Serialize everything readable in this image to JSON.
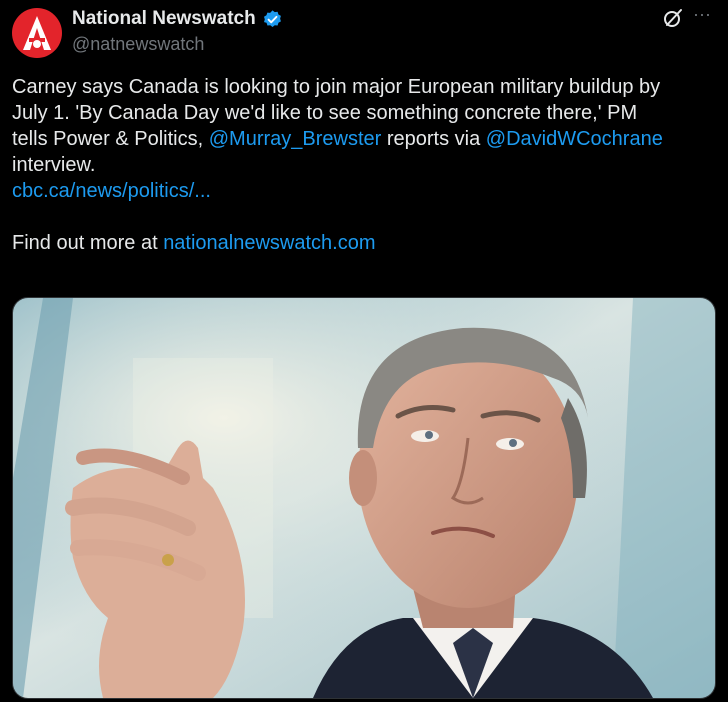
{
  "author": {
    "display_name": "National Newswatch",
    "handle": "@natnewswatch",
    "verified": true,
    "avatar_color": "#e3242b"
  },
  "tweet": {
    "line1": "Carney says Canada is looking to join major European military buildup by",
    "line2": "July 1. 'By Canada Day we'd like to see something concrete there,' PM",
    "line3_pre": "tells Power & Politics, ",
    "mention1": "@Murray_Brewster",
    "line3_mid": " reports via ",
    "mention2": "@DavidWCochrane",
    "line4": "interview.",
    "link": "cbc.ca/news/politics/...",
    "find_out_pre": "Find out more at ",
    "find_out_link": "nationalnewswatch.com"
  },
  "icons": {
    "grok": "grok-icon",
    "more": "more-icon"
  },
  "colors": {
    "background": "#000000",
    "text": "#e7e9ea",
    "secondary": "#71767b",
    "link": "#1d9bf0",
    "verified": "#1d9bf0"
  }
}
